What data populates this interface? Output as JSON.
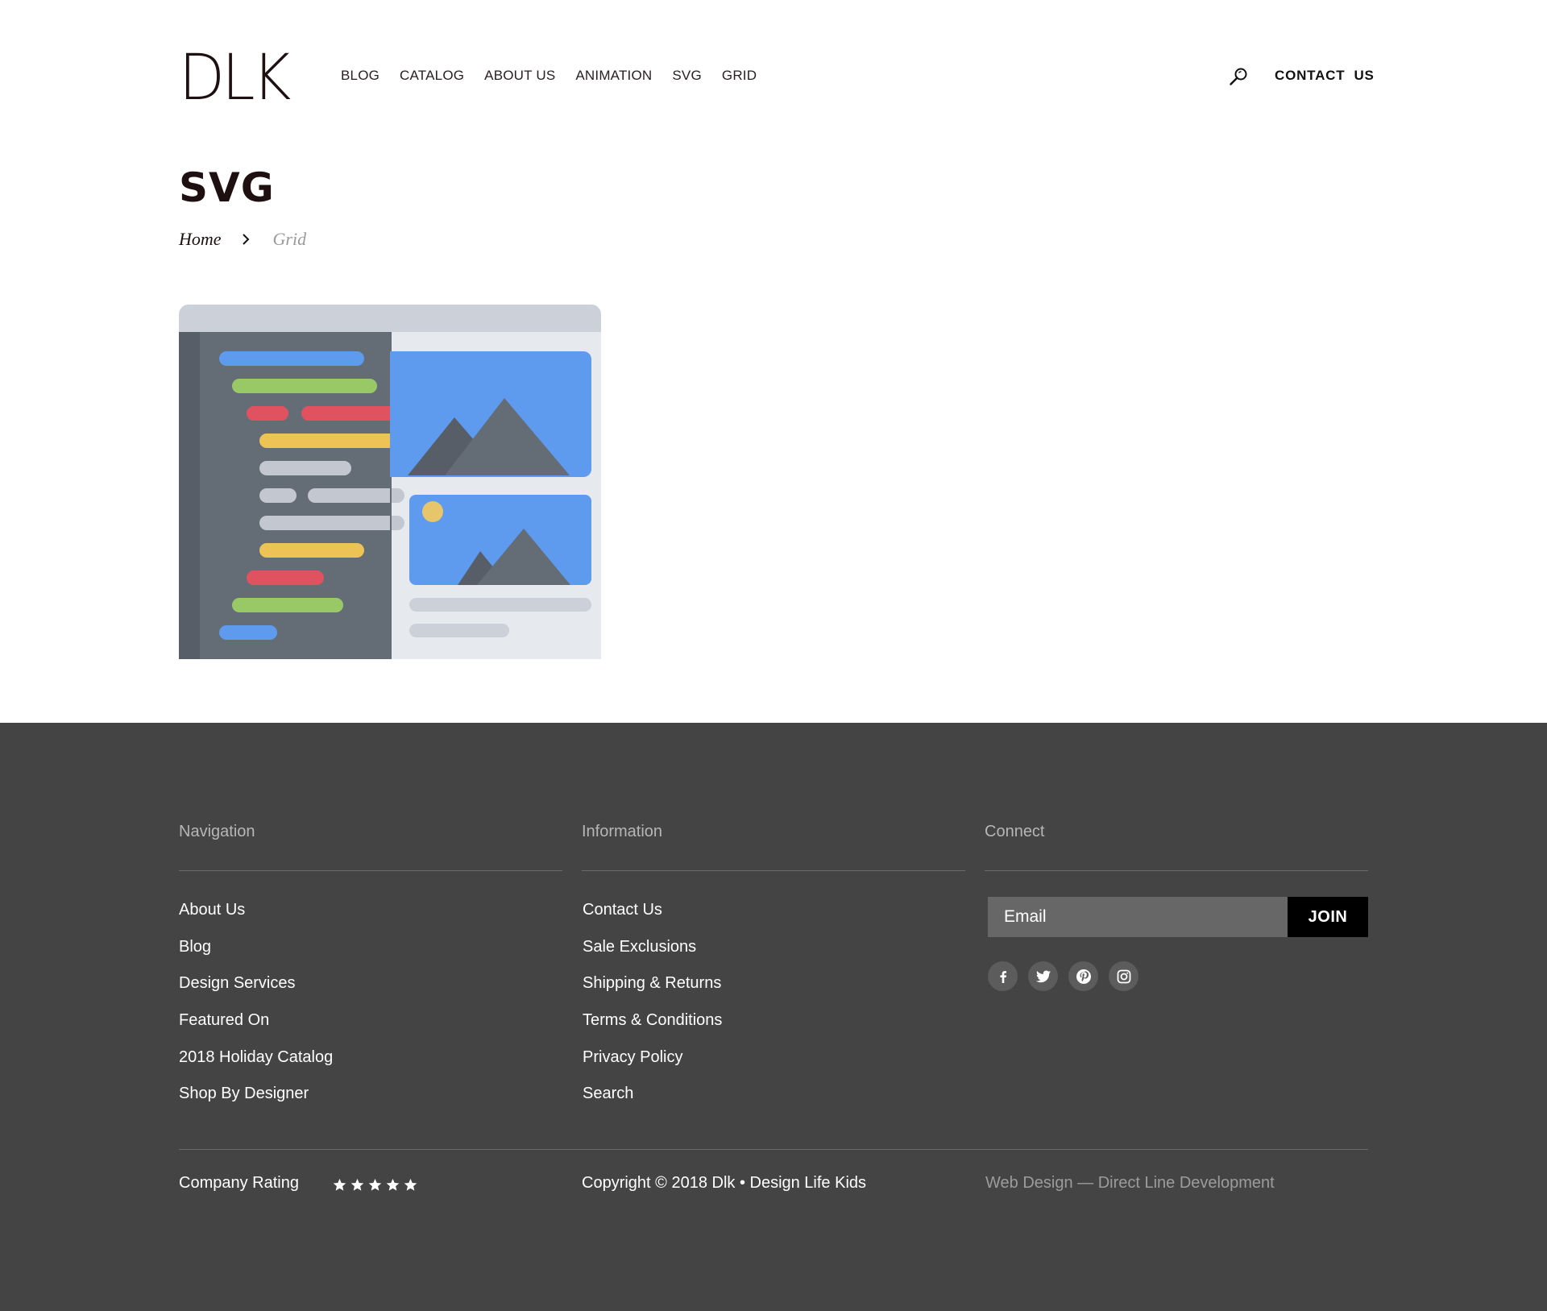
{
  "header": {
    "logo": "DLK",
    "nav": [
      {
        "label": "BLOG"
      },
      {
        "label": "CATALOG"
      },
      {
        "label": "ABOUT US"
      },
      {
        "label": "ANIMATION"
      },
      {
        "label": "SVG"
      },
      {
        "label": "GRID"
      }
    ],
    "search_icon": "search-icon",
    "contact_label": "CONTACT  US"
  },
  "page": {
    "title": "SVG",
    "breadcrumb": {
      "home": "Home",
      "current": "Grid"
    }
  },
  "illustration": {
    "icon": "code-editor-with-image-preview-illustration",
    "colors": {
      "frame": "#ccd0d8",
      "editor": "#646c76",
      "gutter": "#575e68",
      "preview": "#e6e9ee",
      "image_bg": "#5e9aed",
      "mountain": "#646c76",
      "sun": "#e7c56a",
      "line_blue": "#5e9aed",
      "line_green": "#99c967",
      "line_red": "#e0525f",
      "line_yellow": "#eec356",
      "line_grey": "#c3c7cf"
    }
  },
  "footer": {
    "background": "#444444",
    "navigation": {
      "title": "Navigation",
      "links": [
        "About Us",
        "Blog",
        "Design Services",
        "Featured On",
        "2018 Holiday Catalog",
        "Shop By Designer"
      ]
    },
    "information": {
      "title": "Information",
      "links": [
        "Contact Us",
        "Sale Exclusions",
        "Shipping & Returns",
        "Terms & Conditions",
        "Privacy Policy",
        "Search"
      ]
    },
    "connect": {
      "title": "Connect",
      "email_placeholder": "Email",
      "join_label": "JOIN",
      "socials": [
        "facebook-icon",
        "twitter-icon",
        "pinterest-icon",
        "instagram-icon"
      ]
    },
    "rating_label": "Company Rating",
    "rating_stars": 5,
    "copyright": "Copyright © 2018 Dlk • Design Life Kids",
    "credit": "Web Design — Direct Line Development"
  }
}
